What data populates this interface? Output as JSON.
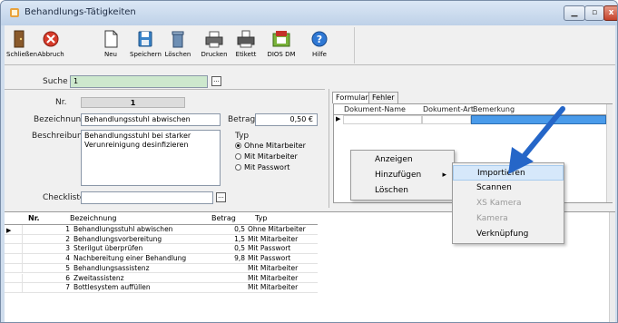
{
  "window": {
    "title": "Behandlungs-Tätigkeiten",
    "close_glyph": "x"
  },
  "toolbar": {
    "items": [
      {
        "label": "Schließen",
        "icon": "exit-icon"
      },
      {
        "label": "Abbruch",
        "icon": "cancel-icon"
      },
      {
        "label": "Neu",
        "icon": "new-document-icon"
      },
      {
        "label": "Speichern",
        "icon": "save-icon"
      },
      {
        "label": "Löschen",
        "icon": "trash-icon"
      },
      {
        "label": "Drucken",
        "icon": "printer-icon"
      },
      {
        "label": "Etikett",
        "icon": "label-printer-icon"
      },
      {
        "label": "DIOS DM",
        "icon": "dios-dm-icon"
      },
      {
        "label": "Hilfe",
        "icon": "help-icon"
      }
    ]
  },
  "search": {
    "label": "Suche",
    "value": "1",
    "button": "..."
  },
  "form": {
    "nr_label": "Nr.",
    "nr_value": "1",
    "bezeichnung_label": "Bezeichnung",
    "bezeichnung_value": "Behandlungsstuhl abwischen",
    "betrag_label": "Betrag",
    "betrag_value": "0,50 €",
    "beschreibung_label": "Beschreibung",
    "beschreibung_value": "Behandlungsstuhl bei starker Verunreinigung desinfizieren",
    "typ_label": "Typ",
    "typ_options": [
      "Ohne Mitarbeiter",
      "Mit Mitarbeiter",
      "Mit Passwort"
    ],
    "typ_selected": "Ohne Mitarbeiter",
    "checkliste_label": "Checkliste",
    "checkliste_value": "",
    "checkliste_button": "..."
  },
  "docs": {
    "tabs": [
      "Formulare",
      "Fehler"
    ],
    "columns": [
      "Dokument-Name",
      "Dokument-Art",
      "Bemerkung"
    ],
    "row_marker": "▶"
  },
  "context_menu": {
    "items": [
      "Anzeigen",
      "Hinzufügen",
      "Löschen"
    ],
    "submenu_arrow": "▸",
    "submenu": [
      {
        "label": "Importieren",
        "enabled": true,
        "highlighted": true
      },
      {
        "label": "Scannen",
        "enabled": true
      },
      {
        "label": "XS Kamera",
        "enabled": false
      },
      {
        "label": "Kamera",
        "enabled": false
      },
      {
        "label": "Verknüpfung",
        "enabled": true
      }
    ]
  },
  "list": {
    "columns": [
      "Nr.",
      "Bezeichnung",
      "Betrag",
      "Typ"
    ],
    "row_marker": "▶",
    "rows": [
      {
        "nr": "1",
        "bezeichnung": "Behandlungsstuhl abwischen",
        "betrag": "0,5",
        "typ": "Ohne Mitarbeiter"
      },
      {
        "nr": "2",
        "bezeichnung": "Behandlungsvorbereitung",
        "betrag": "1,5",
        "typ": "Mit Mitarbeiter"
      },
      {
        "nr": "3",
        "bezeichnung": "Sterilgut überprüfen",
        "betrag": "0,5",
        "typ": "Mit Passwort"
      },
      {
        "nr": "4",
        "bezeichnung": "Nachbereitung einer Behandlung",
        "betrag": "9,8",
        "typ": "Mit Passwort"
      },
      {
        "nr": "5",
        "bezeichnung": "Behandlungsassistenz",
        "betrag": "",
        "typ": "Mit Mitarbeiter"
      },
      {
        "nr": "6",
        "bezeichnung": "Zweitassistenz",
        "betrag": "",
        "typ": "Mit Mitarbeiter"
      },
      {
        "nr": "7",
        "bezeichnung": "Bottlesystem auffüllen",
        "betrag": "",
        "typ": "Mit Mitarbeiter"
      }
    ]
  },
  "colors": {
    "search_bg": "#cde8cd",
    "selected_cell": "#4a9bea",
    "annotation_arrow": "#2566c8",
    "menu_highlight": "#d6e8fa"
  }
}
